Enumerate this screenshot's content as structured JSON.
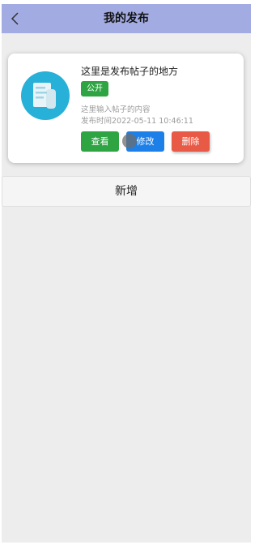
{
  "navbar": {
    "title": "我的发布",
    "back_icon": "chevron-left-icon"
  },
  "posts": [
    {
      "title": "这里是发布帖子的地方",
      "status": "公开",
      "content": "这里输入帖子的内容",
      "time_label": "发布时间2022-05-11 10:46:11",
      "icon": "document-icon",
      "actions": {
        "view": "查看",
        "edit": "修改",
        "delete": "删除"
      }
    }
  ],
  "add_button_label": "新增",
  "colors": {
    "navbar": "#a3ace2",
    "avatar_bg": "#27b0d8",
    "view_button": "#2ea442",
    "edit_button": "#1d7fe8",
    "delete_button": "#e85a45",
    "badge": "#2ea442"
  }
}
